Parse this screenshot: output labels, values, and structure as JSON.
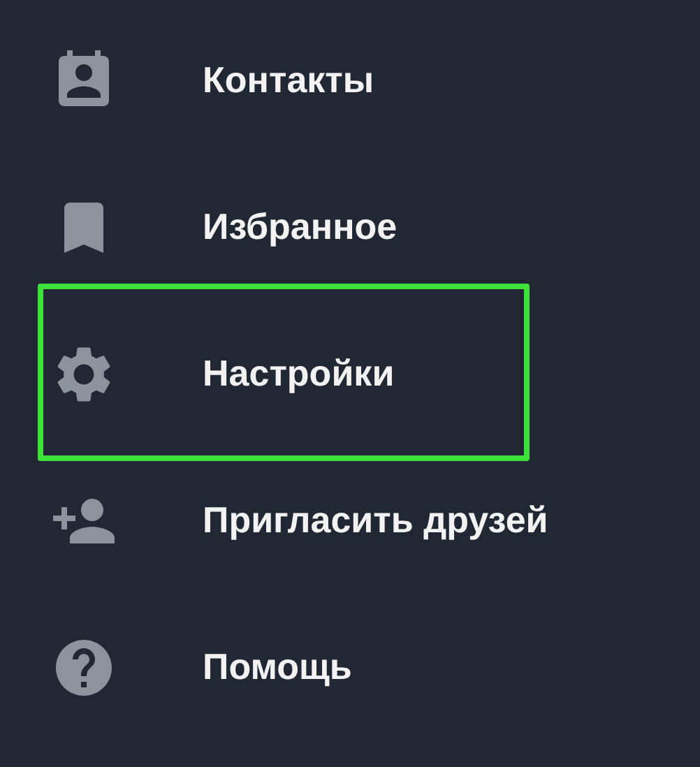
{
  "menu": [
    {
      "kind": "contacts",
      "label": "Контакты",
      "highlighted": false
    },
    {
      "kind": "bookmark",
      "label": "Избранное",
      "highlighted": false
    },
    {
      "kind": "settings",
      "label": "Настройки",
      "highlighted": true
    },
    {
      "kind": "invite",
      "label": "Пригласить друзей",
      "highlighted": false
    },
    {
      "kind": "help",
      "label": "Помощь",
      "highlighted": false
    }
  ]
}
